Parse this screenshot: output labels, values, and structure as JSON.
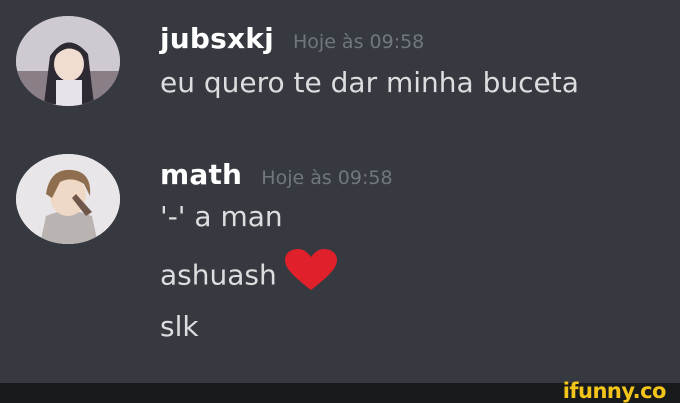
{
  "messages": [
    {
      "username": "jubsxkj",
      "timestamp": "Hoje às 09:58",
      "lines": [
        "eu quero te dar minha buceta"
      ]
    },
    {
      "username": "math",
      "timestamp": "Hoje às 09:58",
      "lines": [
        "'-' a man",
        "ashuash",
        "slk"
      ]
    }
  ],
  "emoji": {
    "heart_color": "#e0202a"
  },
  "watermark": {
    "text": "ifunny.co",
    "color": "#f3c51a"
  },
  "theme": {
    "background": "#36393f",
    "username_color": "#ffffff",
    "text_color": "#dcddde",
    "timestamp_color": "#72767d"
  }
}
